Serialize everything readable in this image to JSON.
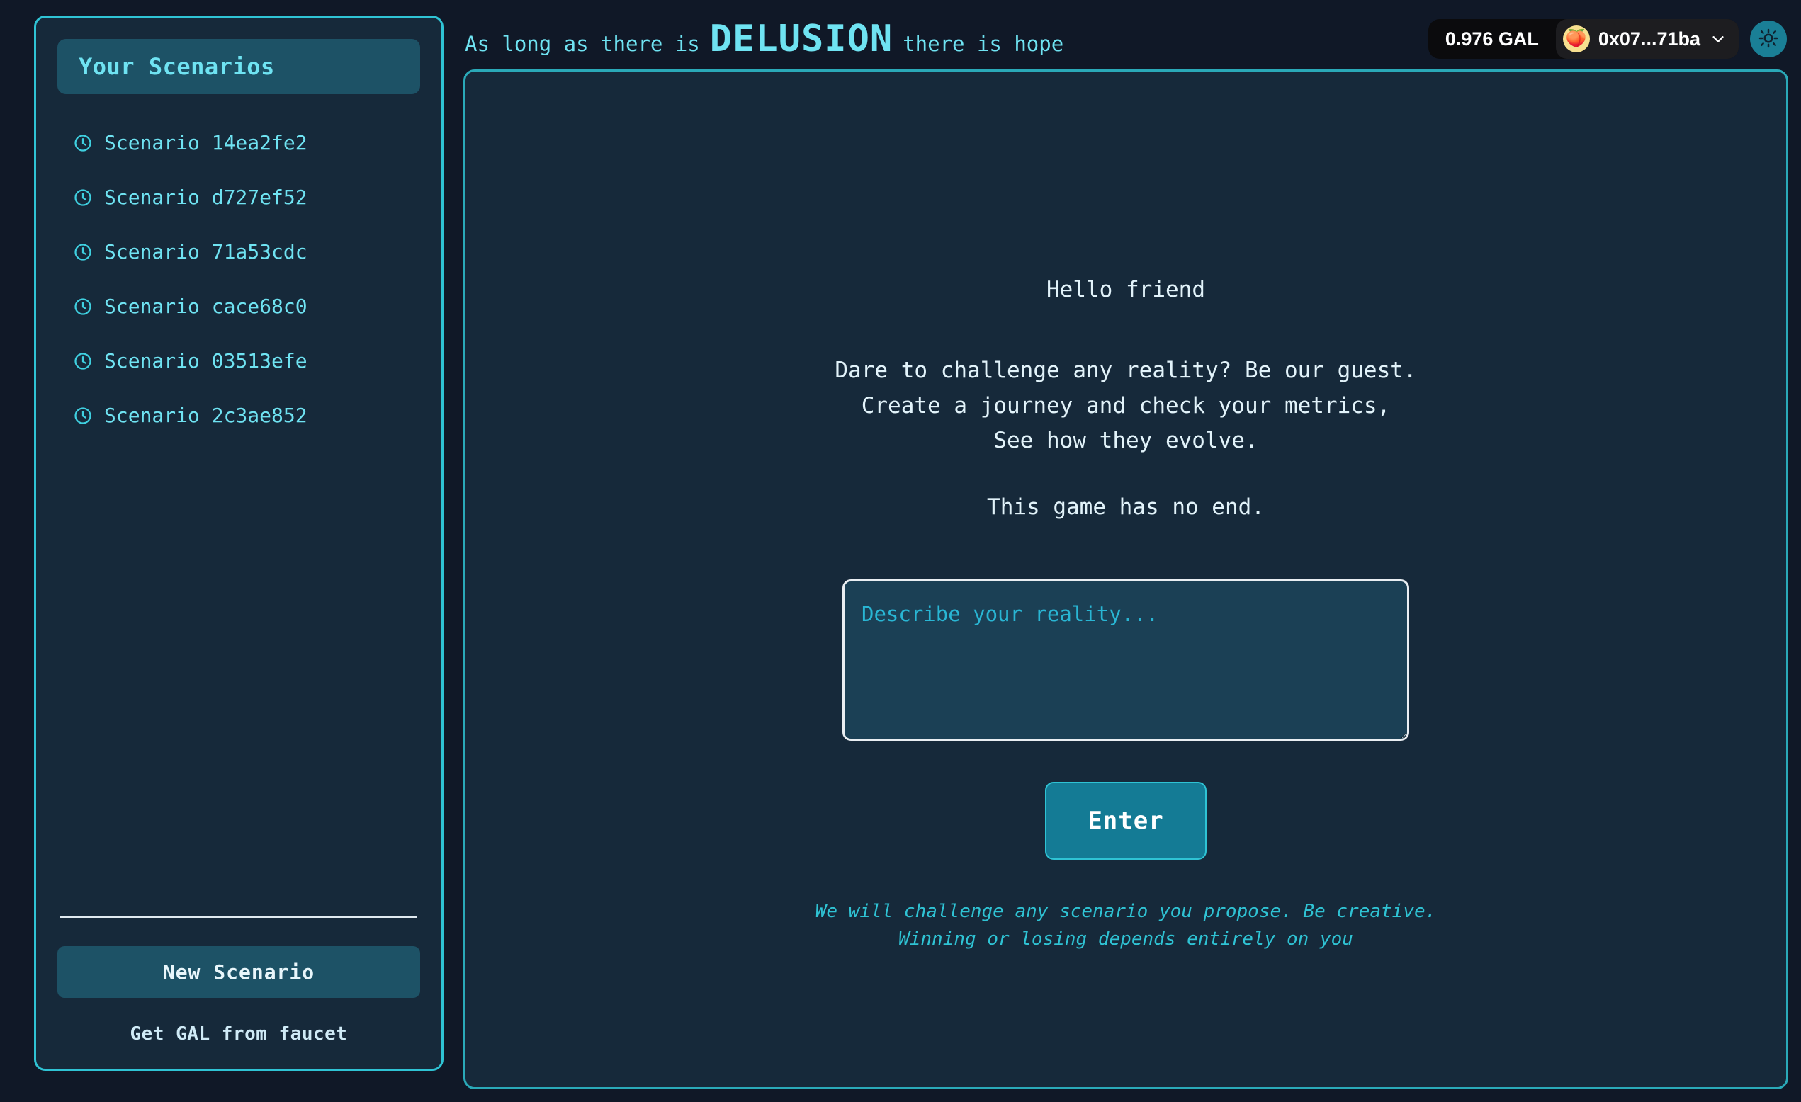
{
  "sidebar": {
    "header_title": "Your Scenarios",
    "scenarios": [
      {
        "label": "Scenario 14ea2fe2",
        "icon": "clock-icon"
      },
      {
        "label": "Scenario d727ef52",
        "icon": "clock-icon"
      },
      {
        "label": "Scenario 71a53cdc",
        "icon": "clock-icon"
      },
      {
        "label": "Scenario cace68c0",
        "icon": "clock-icon"
      },
      {
        "label": "Scenario 03513efe",
        "icon": "clock-icon"
      },
      {
        "label": "Scenario 2c3ae852",
        "icon": "clock-icon"
      }
    ],
    "new_scenario_label": "New Scenario",
    "faucet_label": "Get GAL from faucet"
  },
  "topbar": {
    "tagline_prefix": "As long as there is",
    "brand": "DELUSION",
    "tagline_suffix": "there is hope",
    "wallet": {
      "balance": "0.976 GAL",
      "address": "0x07...71ba",
      "avatar_glyph": "🍑",
      "chevron_icon": "chevron-down-icon"
    },
    "theme_toggle_icon": "sun-icon"
  },
  "main": {
    "greeting": "Hello friend",
    "intro_line_1": "Dare to challenge any reality? Be our guest.",
    "intro_line_2": "Create a journey and check your metrics,",
    "intro_line_3": "See how they evolve.",
    "no_end": "This game has no end.",
    "input_placeholder": "Describe your reality...",
    "input_value": "",
    "enter_label": "Enter",
    "disclaimer_line_1": "We will challenge any scenario you propose. Be creative.",
    "disclaimer_line_2": "Winning or losing depends entirely on you"
  },
  "colors": {
    "page_bg": "#101827",
    "panel_bg": "#16293a",
    "accent_cyan": "#2fc3d4",
    "accent_text": "#6fe3f2",
    "button_teal": "#147b95",
    "sidebar_header_bg": "#1d5266",
    "wallet_bg": "#0b0b0d",
    "text_light": "#e2f3fa"
  }
}
